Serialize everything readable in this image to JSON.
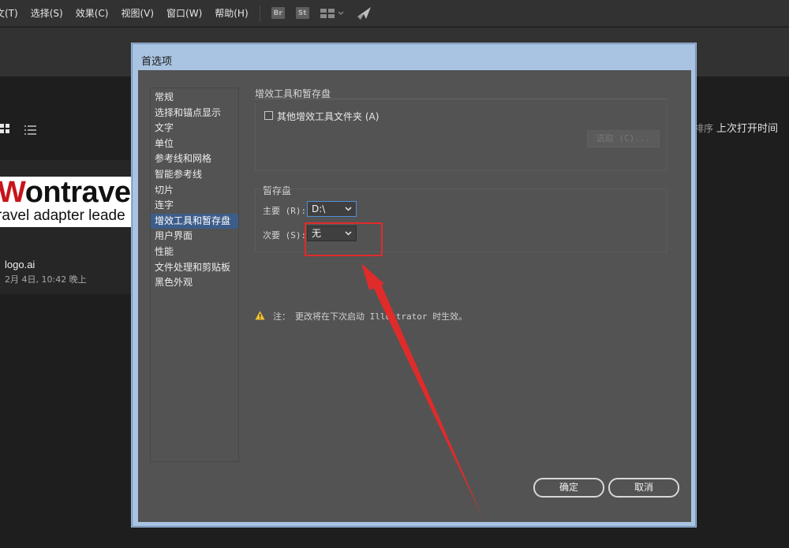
{
  "menubar": {
    "items": [
      "文(T)",
      "选择(S)",
      "效果(C)",
      "视图(V)",
      "窗口(W)",
      "帮助(H)"
    ],
    "icons": [
      "Br",
      "St"
    ]
  },
  "home": {
    "sort_prefix": "排序",
    "sort_value": "上次打开时间",
    "thumb_logo_dark": "Wontrave",
    "thumb_logo_red": "W",
    "thumb_tagline": "ravel adapter leade",
    "file_name": "logo.ai",
    "file_date": "2月 4日, 10:42 晚上"
  },
  "dialog": {
    "title": "首选项",
    "categories": [
      "常规",
      "选择和锚点显示",
      "文字",
      "单位",
      "参考线和网格",
      "智能参考线",
      "切片",
      "连字",
      "增效工具和暂存盘",
      "用户界面",
      "性能",
      "文件处理和剪贴板",
      "黑色外观"
    ],
    "selected_category_index": 8,
    "plugins_title": "增效工具和暂存盘",
    "plugins_checkbox_label": "其他增效工具文件夹 (A)",
    "plugins_checkbox_checked": false,
    "choose_button": "选取 (C)...",
    "scratch_title": "暂存盘",
    "primary_label": "主要 (R):",
    "primary_value": "D:\\",
    "secondary_label": "次要 (S):",
    "secondary_value": "无",
    "note_prefix": "注：",
    "note_text": "更改将在下次启动 Illustrator 时生效。",
    "ok_button": "确定",
    "cancel_button": "取消"
  },
  "colors": {
    "annotation": "#e02b2b",
    "selection": "#3c5d8a",
    "dialog_frame": "#a9c4e2",
    "warning": "#f2c12e"
  }
}
